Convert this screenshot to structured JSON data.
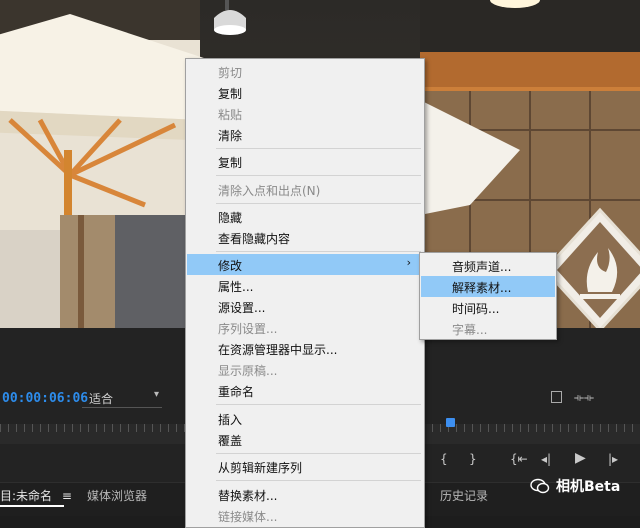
{
  "monitor": {
    "timecode": "00:00:06:06",
    "fit_value": "适合"
  },
  "context_menu": {
    "items": [
      {
        "label": "剪切",
        "enabled": false
      },
      {
        "label": "复制",
        "enabled": true
      },
      {
        "label": "粘贴",
        "enabled": false
      },
      {
        "label": "清除",
        "enabled": true
      },
      {
        "label": "复制",
        "enabled": true
      },
      {
        "label": "清除入点和出点(N)",
        "enabled": false
      },
      {
        "label": "隐藏",
        "enabled": true
      },
      {
        "label": "查看隐藏内容",
        "enabled": true
      },
      {
        "label": "修改",
        "enabled": true,
        "highlighted": true,
        "submenu_arrow": "›"
      },
      {
        "label": "属性...",
        "enabled": true
      },
      {
        "label": "源设置...",
        "enabled": true
      },
      {
        "label": "序列设置...",
        "enabled": false
      },
      {
        "label": "在资源管理器中显示...",
        "enabled": true
      },
      {
        "label": "显示原稿...",
        "enabled": false
      },
      {
        "label": "重命名",
        "enabled": true
      },
      {
        "label": "插入",
        "enabled": true
      },
      {
        "label": "覆盖",
        "enabled": true
      },
      {
        "label": "从剪辑新建序列",
        "enabled": true
      },
      {
        "label": "替换素材...",
        "enabled": true
      },
      {
        "label": "链接媒体...",
        "enabled": false
      }
    ]
  },
  "submenu": {
    "items": [
      {
        "label": "音频声道...",
        "enabled": true
      },
      {
        "label": "解释素材...",
        "enabled": true,
        "highlighted": true
      },
      {
        "label": "时间码...",
        "enabled": true
      },
      {
        "label": "字幕...",
        "enabled": false
      }
    ]
  },
  "bottom_tabs": {
    "project": "目:未命名",
    "media_browser": "媒体浏览器",
    "history": "历史记录"
  },
  "watermark": "相机Beta",
  "colors": {
    "accent_blue": "#2d8ceb",
    "menu_highlight": "#91c9f7",
    "menu_bg": "#f0f0f0"
  }
}
